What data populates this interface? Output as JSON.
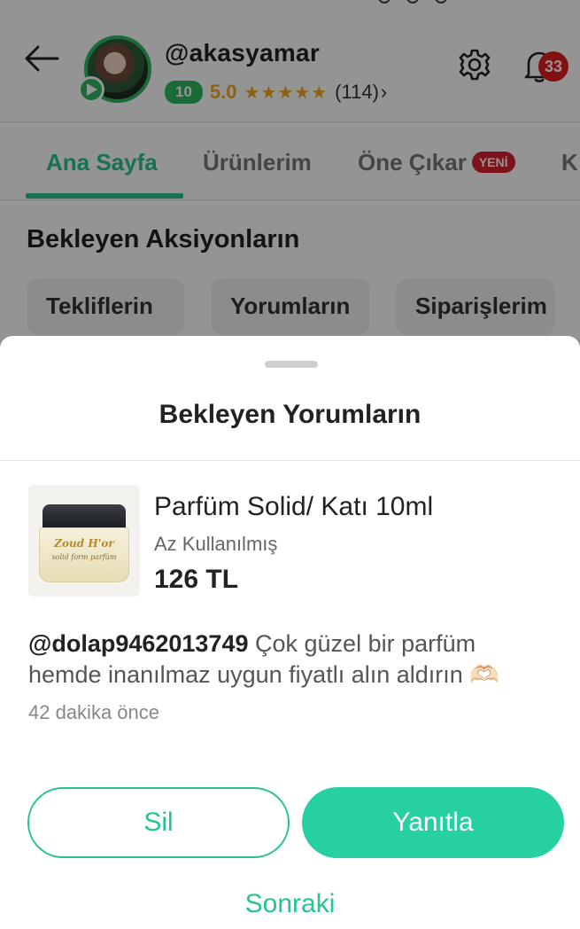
{
  "header": {
    "username": "@akasyamar",
    "level": "10",
    "score": "5.0",
    "stars": "★★★★★",
    "review_count": "(114)",
    "review_chevron": "›",
    "notification_count": "33",
    "icons": {
      "back": "arrow-left-icon",
      "settings": "gear-icon",
      "notifications": "bell-icon"
    }
  },
  "tabs": [
    {
      "label": "Ana Sayfa",
      "active": true
    },
    {
      "label": "Ürünlerim",
      "active": false
    },
    {
      "label": "Öne Çıkar",
      "active": false,
      "badge": "YENİ"
    },
    {
      "label": "K",
      "active": false
    }
  ],
  "main": {
    "section_title": "Bekleyen Aksiyonların",
    "chips": [
      "Tekliflerin",
      "Yorumların",
      "Siparişlerim"
    ]
  },
  "sheet": {
    "title": "Bekleyen Yorumların",
    "product": {
      "name": "Parfüm Solid/ Katı 10ml",
      "condition": "Az Kullanılmış",
      "price": "126 TL",
      "image_brand": "Zoud H'or",
      "image_subtitle": "solid form parfüm"
    },
    "comment": {
      "user": "@dolap9462013749",
      "text": "Çok güzel bir parfüm hemde inanılmaz uygun fiyatlı alın aldırın 🫶🏻",
      "time": "42 dakika önce"
    },
    "actions": {
      "delete_label": "Sil",
      "reply_label": "Yanıtla",
      "next_label": "Sonraki"
    }
  },
  "colors": {
    "accent": "#27c48f",
    "button_fill": "#27d0a0",
    "level_badge": "#2fb864",
    "star": "#f0a91e",
    "badge_red": "#d8212f"
  }
}
